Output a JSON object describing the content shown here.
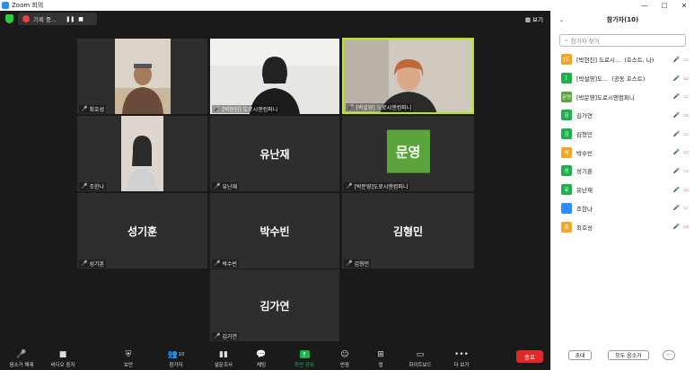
{
  "window": {
    "title": "Zoom 회의",
    "min": "—",
    "max": "☐",
    "close": "✕"
  },
  "topbar": {
    "rec_label": "기록 중...",
    "pause": "❚❚",
    "stop": "■",
    "view_label": "▦ 보기"
  },
  "tiles": [
    {
      "id": "choihosung",
      "name": "최호성",
      "type": "video"
    },
    {
      "id": "parkhyunjin",
      "name": "[박현진] 도로시앤컴퍼니",
      "type": "video"
    },
    {
      "id": "parkseolyoung",
      "name": "[박설영] 도로시앤컴퍼니",
      "type": "video"
    },
    {
      "id": "johanna",
      "name": "조한나",
      "type": "video"
    },
    {
      "id": "yunanjae",
      "name": "유난재",
      "label": "유난재",
      "type": "name"
    },
    {
      "id": "parkmunyoung",
      "name": "[박문영]도로시앤컴퍼니",
      "avatar": "문영",
      "type": "avatar"
    },
    {
      "id": "sunggihun",
      "name": "성기훈",
      "label": "성기훈",
      "type": "name"
    },
    {
      "id": "parksubin",
      "name": "박수빈",
      "label": "박수빈",
      "type": "name"
    },
    {
      "id": "kimhyungmin",
      "name": "김형민",
      "label": "김형민",
      "type": "name"
    },
    {
      "id": "kimgayeon",
      "name": "김가연",
      "label": "김가연",
      "type": "name"
    }
  ],
  "toolbar": {
    "unmute": "음소거 해제",
    "stop_video": "비디오 중지",
    "security": "보안",
    "participants": "참가자",
    "participants_count": "10",
    "polls": "설문조사",
    "chat": "채팅",
    "share": "화면 공유",
    "reactions": "반응",
    "apps": "앱",
    "whiteboard": "화이트보드",
    "more": "더 보기",
    "end": "종료"
  },
  "panel": {
    "title": "참가자(10)",
    "search_placeholder": "참가자 찾기",
    "participants": [
      {
        "avatar": "[도",
        "name": "[박현진] 도로시...",
        "role": "(호스트, 나)",
        "color": "#f5a623"
      },
      {
        "avatar": "[",
        "name": "[박설영]도...",
        "role": "(공동 호스트)",
        "color": "#1cb24b"
      },
      {
        "avatar": "문영",
        "name": "[박문영]도로시앤컴퍼니",
        "role": "",
        "color": "#5ba33b"
      },
      {
        "avatar": "김",
        "name": "김가연",
        "role": "",
        "color": "#1cb24b"
      },
      {
        "avatar": "김",
        "name": "김형민",
        "role": "",
        "color": "#1cb24b"
      },
      {
        "avatar": "박",
        "name": "박수빈",
        "role": "",
        "color": "#f5a623"
      },
      {
        "avatar": "성",
        "name": "성기훈",
        "role": "",
        "color": "#1cb24b"
      },
      {
        "avatar": "유",
        "name": "유난재",
        "role": "",
        "color": "#1cb24b"
      },
      {
        "avatar": "",
        "name": "조한나",
        "role": "",
        "color": "#2d8cff"
      },
      {
        "avatar": "최",
        "name": "최호성",
        "role": "",
        "color": "#f5a623"
      }
    ],
    "invite": "초대",
    "mute_all": "모두 음소거",
    "more": "···"
  }
}
